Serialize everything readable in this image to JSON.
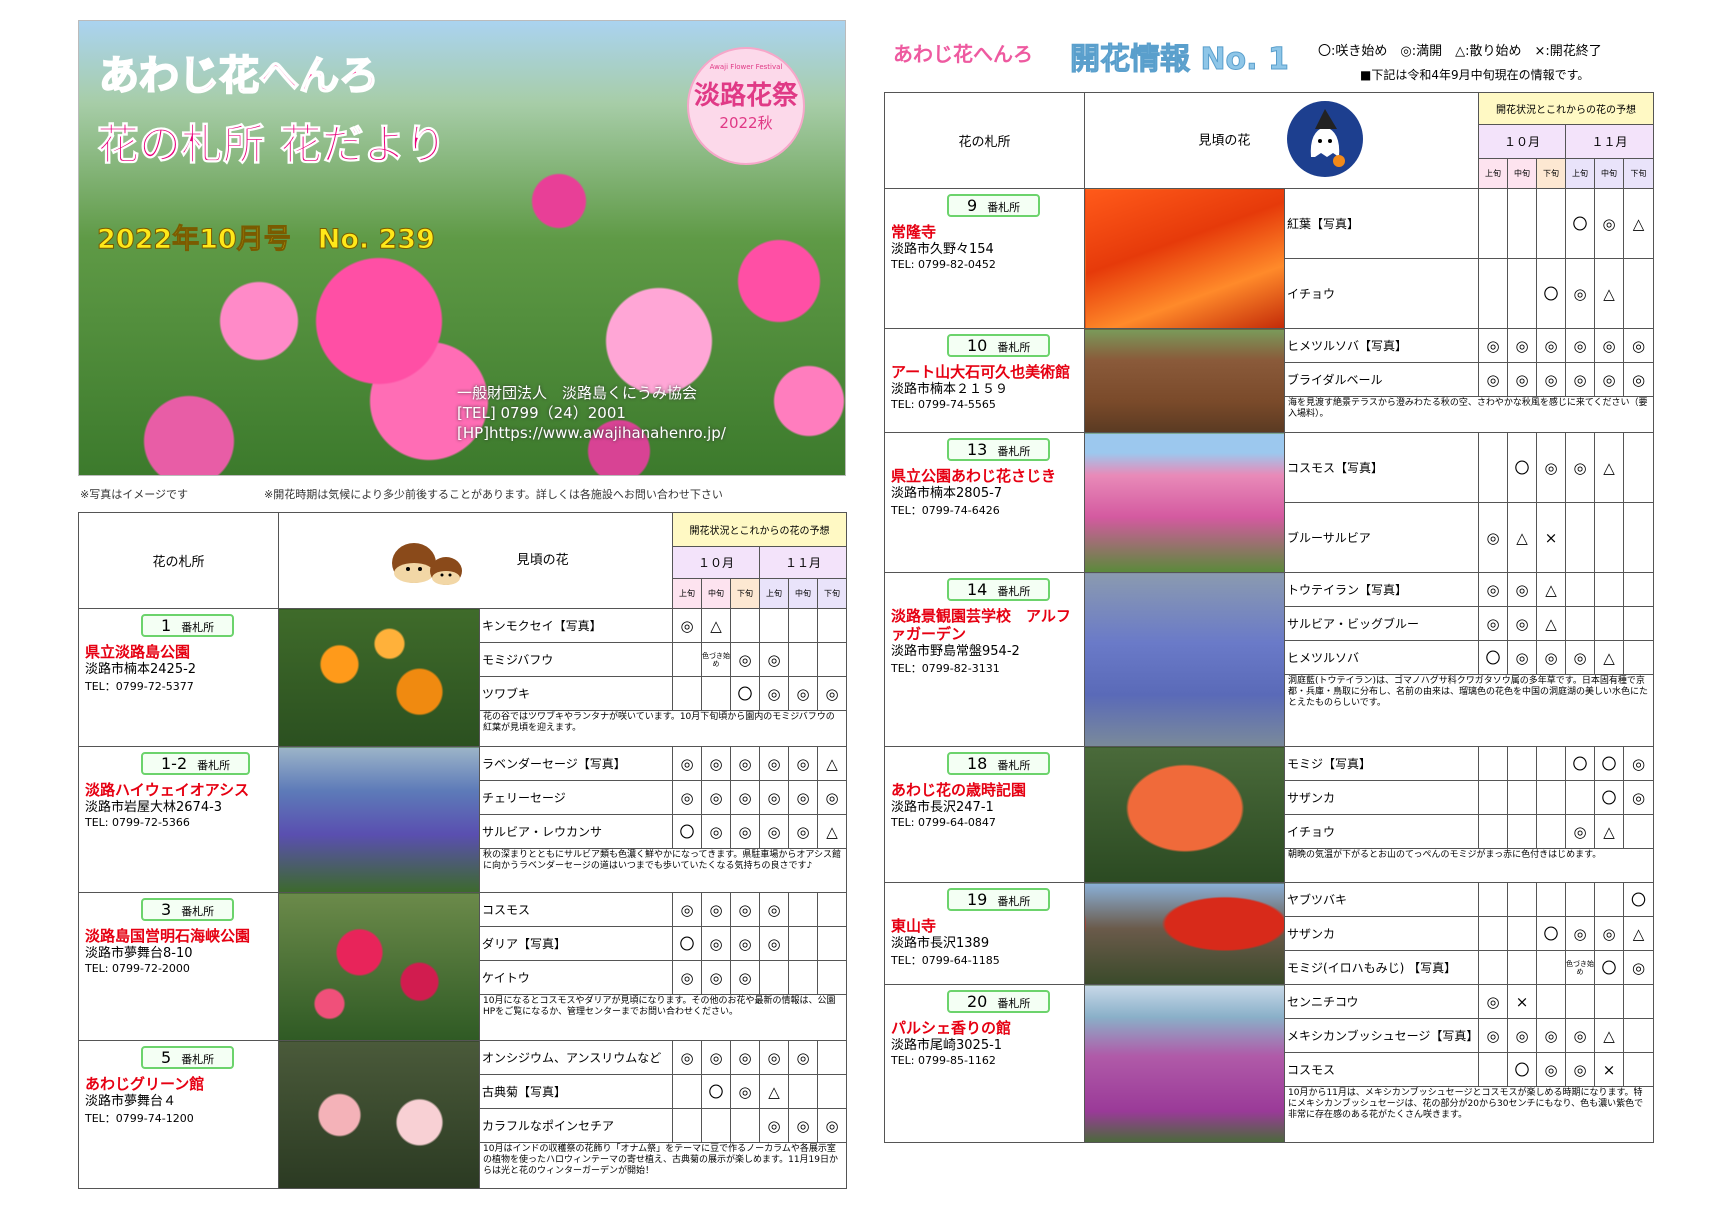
{
  "cover": {
    "title_logo": "あわじ花へんろ",
    "subtitle": "花の札所 花だより",
    "issue": "2022年10月号　No. 239",
    "badge_small": "Awaji Flower Festival",
    "badge_title": "淡路花祭",
    "badge_year": "2022秋",
    "org": "一般財団法人　淡路島くにうみ協会",
    "tel": "[TEL] 0799（24）2001",
    "hp": "[HP]https://www.awajihanahenro.jp/"
  },
  "notes": {
    "photo": "※写真はイメージです",
    "timing": "※開花時期は気候により多少前後することがあります。詳しくは各施設へお問い合わせ下さい"
  },
  "right_header": {
    "logo": "あわじ花へんろ",
    "title": "開花情報 No. 1",
    "legend": "〇:咲き始め　◎:満開　△:散り始め　×:開花終了",
    "date_note": "■下記は令和4年9月中旬現在の情報です。"
  },
  "table_header": {
    "col_place": "花の札所",
    "col_flower": "見頃の花",
    "forecast": "開花状況とこれからの花の予想",
    "oct": "１０月",
    "nov": "１１月",
    "jo": "上旬",
    "chu": "中旬",
    "ge": "下旬"
  },
  "unit": "番札所",
  "left_sites": [
    {
      "num": "1",
      "name": "県立淡路島公園",
      "addr": "淡路市楠本2425-2",
      "tel": "TEL：0799-72-5377",
      "photo": "orange",
      "flowers": [
        {
          "name": "キンモクセイ【写真】",
          "s": [
            "◎",
            "△",
            "",
            "",
            "",
            ""
          ]
        },
        {
          "name": "モミジバフウ",
          "s": [
            "",
            "色づき始め",
            "◎",
            "◎",
            "",
            ""
          ]
        },
        {
          "name": "ツワブキ",
          "s": [
            "",
            "",
            "〇",
            "◎",
            "◎",
            "◎"
          ]
        }
      ],
      "comment": "花の谷ではツワブキやランタナが咲いています。10月下旬頃から園内のモミジバフウの紅葉が見頃を迎えます。"
    },
    {
      "num": "1-2",
      "name": "淡路ハイウェイオアシス",
      "addr": "淡路市岩屋大林2674-3",
      "tel": "TEL: 0799-72-5366",
      "photo": "purple",
      "flowers": [
        {
          "name": "ラベンダーセージ【写真】",
          "s": [
            "◎",
            "◎",
            "◎",
            "◎",
            "◎",
            "△"
          ]
        },
        {
          "name": "チェリーセージ",
          "s": [
            "◎",
            "◎",
            "◎",
            "◎",
            "◎",
            "◎"
          ]
        },
        {
          "name": "サルビア・レウカンサ",
          "s": [
            "〇",
            "◎",
            "◎",
            "◎",
            "◎",
            "△"
          ]
        }
      ],
      "comment": "秋の深まりとともにサルビア類も色濃く鮮やかになってきます。県駐車場からオアシス館に向かうラベンダーセージの道はいつまでも歩いていたくなる気持ちの良さです♪"
    },
    {
      "num": "3",
      "name": "淡路島国営明石海峡公園",
      "addr": "淡路市夢舞台8-10",
      "tel": "TEL: 0799-72-2000",
      "photo": "red",
      "flowers": [
        {
          "name": "コスモス",
          "s": [
            "◎",
            "◎",
            "◎",
            "◎",
            "",
            ""
          ]
        },
        {
          "name": "ダリア【写真】",
          "s": [
            "〇",
            "◎",
            "◎",
            "◎",
            "",
            ""
          ]
        },
        {
          "name": "ケイトウ",
          "s": [
            "◎",
            "◎",
            "◎",
            "",
            "",
            ""
          ]
        }
      ],
      "comment": "10月になるとコスモスやダリアが見頃になります。その他のお花や最新の情報は、公園HPをご覧になるか、管理センターまでお問い合わせください。"
    },
    {
      "num": "5",
      "name": "あわじグリーン館",
      "addr": "淡路市夢舞台４",
      "tel": "TEL：0799-74-1200",
      "photo": "pinkwhite",
      "flowers": [
        {
          "name": "オンシジウム、アンスリウムなど",
          "s": [
            "◎",
            "◎",
            "◎",
            "◎",
            "◎",
            ""
          ]
        },
        {
          "name": "古典菊【写真】",
          "s": [
            "",
            "〇",
            "◎",
            "△",
            "",
            ""
          ]
        },
        {
          "name": "カラフルなポインセチア",
          "s": [
            "",
            "",
            "",
            "◎",
            "◎",
            "◎"
          ]
        }
      ],
      "comment": "10月はインドの収穫祭の花飾り「オナム祭」をテーマに豆で作るノーカラムや各展示室の植物を使ったハロウィンテーマの寄せ植え、古典菊の展示が楽しめます。11月19日からは光と花のウィンターガーデンが開始！"
    }
  ],
  "right_sites": [
    {
      "num": "9",
      "name": "常隆寺",
      "addr": "淡路市久野々154",
      "tel": "TEL: 0799-82-0452",
      "photo": "autumn",
      "flowers": [
        {
          "name": "紅葉【写真】",
          "s": [
            "",
            "",
            "",
            "〇",
            "◎",
            "△"
          ]
        },
        {
          "name": "イチョウ",
          "s": [
            "",
            "",
            "〇",
            "◎",
            "△",
            ""
          ]
        }
      ],
      "comment": ""
    },
    {
      "num": "10",
      "name": "アート山大石可久也美術館",
      "addr": "淡路市楠本２１５９",
      "tel": "TEL: 0799-74-5565",
      "photo": "brown",
      "flowers": [
        {
          "name": "ヒメツルソバ【写真】",
          "s": [
            "◎",
            "◎",
            "◎",
            "◎",
            "◎",
            "◎"
          ]
        },
        {
          "name": "ブライダルベール",
          "s": [
            "◎",
            "◎",
            "◎",
            "◎",
            "◎",
            "◎"
          ]
        }
      ],
      "comment": "海を見渡す絶景テラスから澄みわたる秋の空、さわやかな秋風を感じに来てください（要入場料）。"
    },
    {
      "num": "13",
      "name": "県立公園あわじ花さじき",
      "addr": "淡路市楠本2805-7",
      "tel": "TEL：0799-74-6426",
      "photo": "cosmos",
      "flowers": [
        {
          "name": "コスモス【写真】",
          "s": [
            "",
            "〇",
            "◎",
            "◎",
            "△",
            ""
          ]
        },
        {
          "name": "ブルーサルビア",
          "s": [
            "◎",
            "△",
            "×",
            "",
            "",
            ""
          ]
        }
      ],
      "comment": ""
    },
    {
      "num": "14",
      "name": "淡路景観園芸学校　アルファガーデン",
      "addr": "淡路市野島常盤954-2",
      "tel": "TEL：0799-82-3131",
      "photo": "blue",
      "flowers": [
        {
          "name": "トウテイラン【写真】",
          "s": [
            "◎",
            "◎",
            "△",
            "",
            "",
            ""
          ]
        },
        {
          "name": "サルビア・ビッグブルー",
          "s": [
            "◎",
            "◎",
            "△",
            "",
            "",
            ""
          ]
        },
        {
          "name": "ヒメツルソバ",
          "s": [
            "〇",
            "◎",
            "◎",
            "◎",
            "△",
            ""
          ]
        }
      ],
      "comment": "洞庭藍(トウテイラン)は、ゴマノハグサ科クワガタソウ属の多年草です。日本固有種で京都・兵庫・鳥取に分布し、名前の由来は、瑠璃色の花色を中国の洞庭湖の美しい水色にたとえたものらしいです。"
    },
    {
      "num": "18",
      "name": "あわじ花の歳時記園",
      "addr": "淡路市長沢247-1",
      "tel": "TEL: 0799-64-0847",
      "photo": "maple",
      "flowers": [
        {
          "name": "モミジ【写真】",
          "s": [
            "",
            "",
            "",
            "〇",
            "〇",
            "◎"
          ]
        },
        {
          "name": "サザンカ",
          "s": [
            "",
            "",
            "",
            "",
            "〇",
            "◎"
          ]
        },
        {
          "name": "イチョウ",
          "s": [
            "",
            "",
            "",
            "◎",
            "△",
            ""
          ]
        }
      ],
      "comment": "朝晩の気温が下がるとお山のてっぺんのモミジがまっ赤に色付きはじめます。"
    },
    {
      "num": "19",
      "name": "東山寺",
      "addr": "淡路市長沢1389",
      "tel": "TEL：0799-64-1185",
      "photo": "temple",
      "flowers": [
        {
          "name": "ヤブツバキ",
          "s": [
            "",
            "",
            "",
            "",
            "",
            "〇"
          ]
        },
        {
          "name": "サザンカ",
          "s": [
            "",
            "",
            "〇",
            "◎",
            "◎",
            "△"
          ]
        },
        {
          "name": "モミジ(イロハもみじ) 【写真】",
          "s": [
            "",
            "",
            "",
            "色づき始め",
            "〇",
            "◎"
          ]
        }
      ],
      "comment": ""
    },
    {
      "num": "20",
      "name": "パルシェ香りの館",
      "addr": "淡路市尾崎3025-1",
      "tel": "TEL: 0799-85-1162",
      "photo": "mauve",
      "flowers": [
        {
          "name": "センニチコウ",
          "s": [
            "◎",
            "×",
            "",
            "",
            "",
            ""
          ]
        },
        {
          "name": "メキシカンブッシュセージ【写真】",
          "s": [
            "◎",
            "◎",
            "◎",
            "◎",
            "△",
            ""
          ]
        },
        {
          "name": "コスモス",
          "s": [
            "",
            "〇",
            "◎",
            "◎",
            "×",
            ""
          ]
        }
      ],
      "comment": "10月から11月は、メキシカンブッシュセージとコスモスが楽しめる時期になります。特にメキシカンブッシュセージは、花の部分が20から30センチにもなり、色も濃い紫色で非常に存在感のある花がたくさん咲きます。"
    }
  ]
}
